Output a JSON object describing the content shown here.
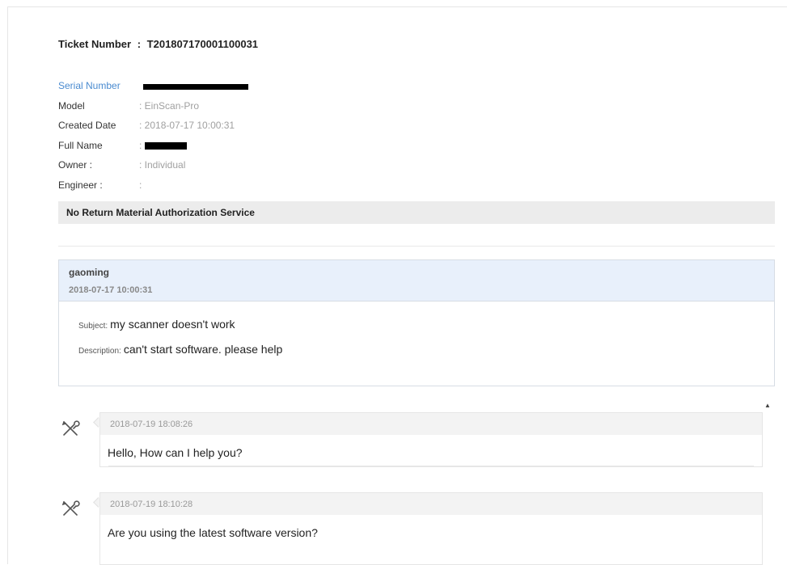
{
  "ticket": {
    "label": "Ticket Number",
    "sep": ":",
    "number": "T201807170001100031"
  },
  "info": {
    "serial": {
      "label": "Serial Number"
    },
    "model": {
      "label": "Model",
      "value": ": EinScan-Pro"
    },
    "created": {
      "label": "Created Date",
      "value": ": 2018-07-17 10:00:31"
    },
    "fullname": {
      "label": "Full Name",
      "prefix": ":"
    },
    "owner": {
      "label": "Owner :",
      "value": ": Individual"
    },
    "engineer": {
      "label": "Engineer :",
      "value": ":"
    }
  },
  "rma": {
    "label": "No Return Material Authorization Service"
  },
  "message": {
    "author": "gaoming",
    "date": "2018-07-17 10:00:31",
    "subject_label": "Subject:",
    "subject": "my scanner doesn't work",
    "description_label": "Description:",
    "description": "can't start software. please help"
  },
  "replies": [
    {
      "time": "2018-07-19 18:08:26",
      "text": "Hello, How can I help you?",
      "icon": "tools-icon"
    },
    {
      "time": "2018-07-19 18:10:28",
      "text": "Are you using the latest software version?",
      "icon": "tools-icon"
    }
  ],
  "colors": {
    "label_blue": "#4a8bd0",
    "message_header_bg": "#e8f0fb",
    "rma_bar_bg": "#ececec"
  },
  "scroll": {
    "up_glyph": "▲"
  }
}
